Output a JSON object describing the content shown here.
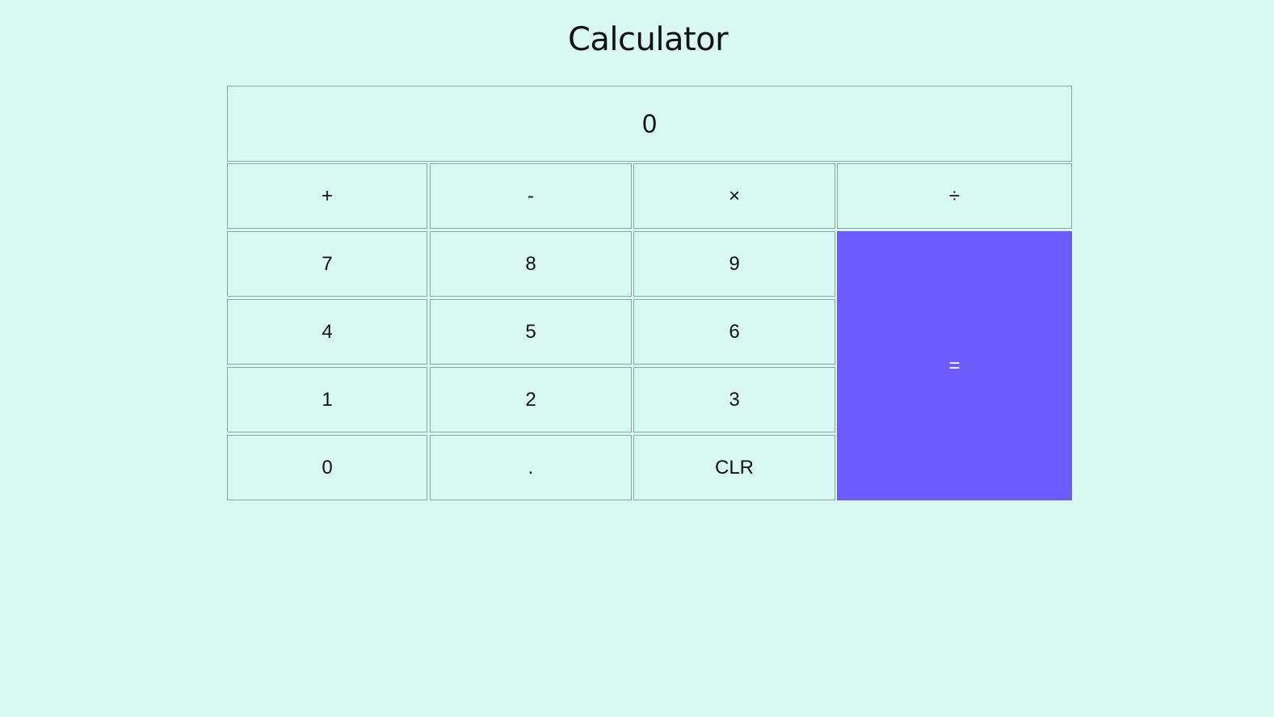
{
  "page": {
    "title": "Calculator"
  },
  "display": {
    "value": "0"
  },
  "keys": {
    "add": "+",
    "subtract": "-",
    "multiply": "×",
    "divide": "÷",
    "seven": "7",
    "eight": "8",
    "nine": "9",
    "four": "4",
    "five": "5",
    "six": "6",
    "one": "1",
    "two": "2",
    "three": "3",
    "zero": "0",
    "decimal": ".",
    "clear": "CLR",
    "equals": "="
  },
  "colors": {
    "background": "#d8f8f0",
    "equals_button": "#6c5cff",
    "border": "#8aa8a6"
  }
}
